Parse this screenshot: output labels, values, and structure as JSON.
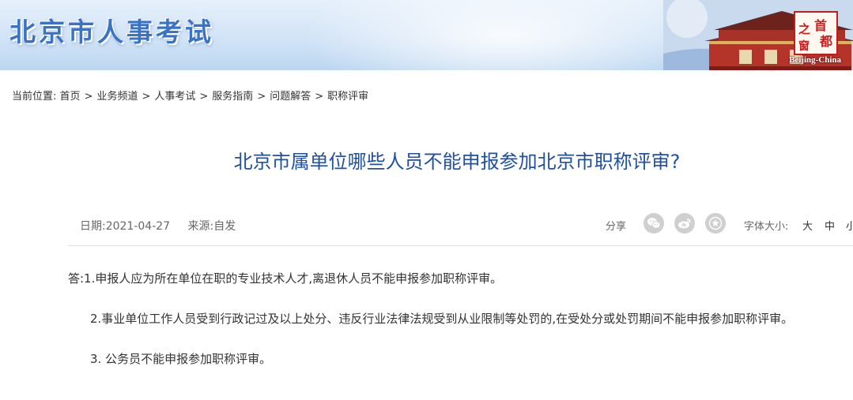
{
  "header": {
    "site_title": "北京市人事考试",
    "seal_chars": [
      "首",
      "之",
      "都",
      "窗"
    ],
    "seal_caption": "Beijing-China"
  },
  "breadcrumb": {
    "prefix": "当前位置:",
    "items": [
      "首页",
      "业务频道",
      "人事考试",
      "服务指南",
      "问题解答",
      "职称评审"
    ],
    "separator": ">"
  },
  "article": {
    "title": "北京市属单位哪些人员不能申报参加北京市职称评审?",
    "date_label": "日期:",
    "date": "2021-04-27",
    "source_label": "来源:",
    "source": "自发",
    "share_label": "分享",
    "share_icons": [
      "wechat-icon",
      "weibo-icon",
      "favorite-star-icon"
    ],
    "font_size_label": "字体大小:",
    "font_options": [
      "大",
      "中",
      "小"
    ],
    "paragraphs": [
      "答:1.申报人应为所在单位在职的专业技术人才,离退休人员不能申报参加职称评审。",
      "2.事业单位工作人员受到行政记过及以上处分、违反行业法律法规受到从业限制等处罚的,在受处分或处罚期间不能申报参加职称评审。",
      "3. 公务员不能申报参加职称评审。"
    ]
  },
  "colors": {
    "title": "#20509e",
    "site_title": "#3a73c4",
    "seal_red": "#c81b1b",
    "icon_gray": "#cfcfcf"
  }
}
